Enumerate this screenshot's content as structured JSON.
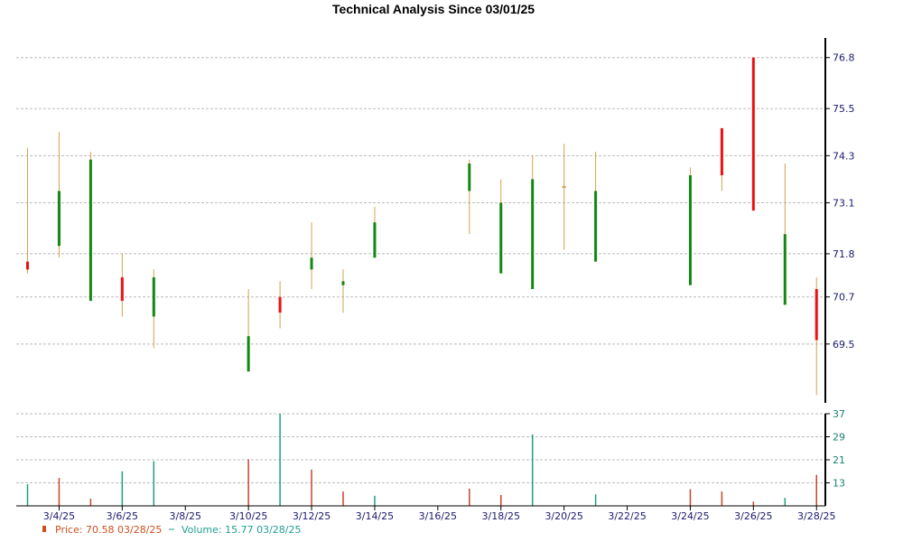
{
  "chart_data": {
    "type": "candlestick",
    "title": "Technical Analysis Since 03/01/25",
    "price_axis": {
      "ticks": [
        69.5,
        70.7,
        71.8,
        73.1,
        74.3,
        75.5,
        76.8
      ],
      "range": [
        68.0,
        77.3
      ]
    },
    "volume_axis": {
      "ticks": [
        13,
        29,
        21,
        37
      ],
      "range": [
        5,
        37
      ]
    },
    "date_ticks": [
      "3/4/25",
      "3/6/25",
      "3/8/25",
      "3/10/25",
      "3/12/25",
      "3/14/25",
      "3/16/25",
      "3/18/25",
      "3/20/25",
      "3/22/25",
      "3/24/25",
      "3/26/25",
      "3/28/25"
    ],
    "grid": true,
    "candles": [
      {
        "date": "3/3/25",
        "open": 71.4,
        "close": 71.6,
        "high": 74.5,
        "low": 71.3,
        "dir": "down"
      },
      {
        "date": "3/4/25",
        "open": 72.0,
        "close": 73.4,
        "high": 74.9,
        "low": 71.7,
        "dir": "up"
      },
      {
        "date": "3/5/25",
        "open": 70.6,
        "close": 74.2,
        "high": 74.4,
        "low": 70.6,
        "dir": "up"
      },
      {
        "date": "3/6/25",
        "open": 71.2,
        "close": 70.6,
        "high": 71.8,
        "low": 70.2,
        "dir": "down"
      },
      {
        "date": "3/7/25",
        "open": 70.2,
        "close": 71.2,
        "high": 71.4,
        "low": 69.4,
        "dir": "up"
      },
      {
        "date": "3/10/25",
        "open": 68.8,
        "close": 69.7,
        "high": 70.9,
        "low": 68.8,
        "dir": "up"
      },
      {
        "date": "3/11/25",
        "open": 70.7,
        "close": 70.3,
        "high": 71.1,
        "low": 69.9,
        "dir": "down"
      },
      {
        "date": "3/12/25",
        "open": 71.4,
        "close": 71.7,
        "high": 72.6,
        "low": 70.9,
        "dir": "up"
      },
      {
        "date": "3/13/25",
        "open": 71.0,
        "close": 71.1,
        "high": 71.4,
        "low": 70.3,
        "dir": "up"
      },
      {
        "date": "3/14/25",
        "open": 71.7,
        "close": 72.6,
        "high": 73.0,
        "low": 71.7,
        "dir": "up"
      },
      {
        "date": "3/17/25",
        "open": 73.4,
        "close": 74.1,
        "high": 74.2,
        "low": 72.3,
        "dir": "up"
      },
      {
        "date": "3/18/25",
        "open": 71.3,
        "close": 73.1,
        "high": 73.7,
        "low": 71.3,
        "dir": "up"
      },
      {
        "date": "3/19/25",
        "open": 70.9,
        "close": 73.7,
        "high": 74.3,
        "low": 70.9,
        "dir": "up"
      },
      {
        "date": "3/20/25",
        "open": 73.5,
        "close": 73.5,
        "high": 74.6,
        "low": 71.9,
        "dir": "flat"
      },
      {
        "date": "3/21/25",
        "open": 71.6,
        "close": 73.4,
        "high": 74.4,
        "low": 71.6,
        "dir": "up"
      },
      {
        "date": "3/24/25",
        "open": 71.0,
        "close": 73.8,
        "high": 74.0,
        "low": 71.0,
        "dir": "up"
      },
      {
        "date": "3/25/25",
        "open": 75.0,
        "close": 73.8,
        "high": 75.0,
        "low": 73.4,
        "dir": "down"
      },
      {
        "date": "3/26/25",
        "open": 76.8,
        "close": 72.9,
        "high": 76.8,
        "low": 72.9,
        "dir": "down"
      },
      {
        "date": "3/27/25",
        "open": 70.5,
        "close": 72.3,
        "high": 74.1,
        "low": 70.5,
        "dir": "up"
      },
      {
        "date": "3/28/25",
        "open": 70.9,
        "close": 69.6,
        "high": 71.2,
        "low": 68.2,
        "dir": "down"
      }
    ],
    "volumes": [
      {
        "date": "3/3/25",
        "value": 12.5,
        "dir": "up"
      },
      {
        "date": "3/4/25",
        "value": 14.7,
        "dir": "down"
      },
      {
        "date": "3/5/25",
        "value": 7.5,
        "dir": "down"
      },
      {
        "date": "3/6/25",
        "value": 17.0,
        "dir": "up"
      },
      {
        "date": "3/7/25",
        "value": 20.5,
        "dir": "up"
      },
      {
        "date": "3/10/25",
        "value": 21.2,
        "dir": "down"
      },
      {
        "date": "3/11/25",
        "value": 37.0,
        "dir": "up"
      },
      {
        "date": "3/12/25",
        "value": 17.6,
        "dir": "down"
      },
      {
        "date": "3/13/25",
        "value": 10.0,
        "dir": "down"
      },
      {
        "date": "3/14/25",
        "value": 8.5,
        "dir": "up"
      },
      {
        "date": "3/17/25",
        "value": 11.0,
        "dir": "down"
      },
      {
        "date": "3/18/25",
        "value": 8.8,
        "dir": "down"
      },
      {
        "date": "3/19/25",
        "value": 29.8,
        "dir": "up"
      },
      {
        "date": "3/21/25",
        "value": 9.0,
        "dir": "up"
      },
      {
        "date": "3/24/25",
        "value": 10.8,
        "dir": "down"
      },
      {
        "date": "3/25/25",
        "value": 10.0,
        "dir": "down"
      },
      {
        "date": "3/26/25",
        "value": 6.5,
        "dir": "down"
      },
      {
        "date": "3/27/25",
        "value": 7.8,
        "dir": "up"
      },
      {
        "date": "3/28/25",
        "value": 15.77,
        "dir": "down"
      }
    ],
    "legend": {
      "price_label": "Price: 70.58  03/28/25",
      "volume_label": "Volume: 15.77  03/28/25"
    },
    "colors": {
      "up": "#118811",
      "down": "#ee1111",
      "wick": "#d4a050",
      "volume_up": "#1ba080",
      "volume_down": "#c8442a",
      "tick_price": "#1a1a6e",
      "tick_volume": "#1a8070",
      "grid": "#bbbbbb",
      "legend_price": "#d05020",
      "legend_volume": "#20a090"
    }
  }
}
